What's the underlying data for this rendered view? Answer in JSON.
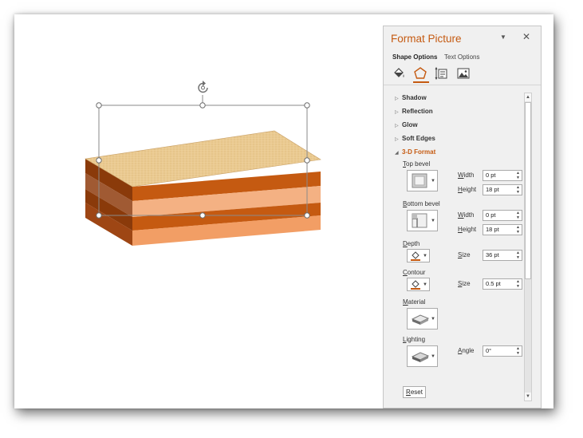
{
  "pane": {
    "title": "Format Picture",
    "menu_icon": "caret-down-icon",
    "close_icon": "close-icon",
    "tabs": [
      "Shape Options",
      "Text Options"
    ],
    "icon_tabs": [
      "fill-line-icon",
      "effects-pentagon-icon",
      "size-properties-icon",
      "picture-icon"
    ],
    "accent_color": "#c55a11"
  },
  "sections": {
    "shadow": "Shadow",
    "reflection": "Reflection",
    "glow": "Glow",
    "soft_edges": "Soft Edges",
    "format_3d": "3-D Format"
  },
  "format_3d": {
    "top_bevel": {
      "label_pre": "",
      "label_key": "T",
      "label_post": "op bevel"
    },
    "bottom_bevel": {
      "label_pre": "",
      "label_key": "B",
      "label_post": "ottom bevel"
    },
    "width_label": {
      "key": "W",
      "rest": "idth"
    },
    "height_label": {
      "key": "H",
      "rest": "eight"
    },
    "top_width": "0 pt",
    "top_height": "18 pt",
    "bottom_width": "0 pt",
    "bottom_height": "18 pt",
    "depth": {
      "key": "D",
      "rest": "epth"
    },
    "depth_size_label": {
      "key": "S",
      "rest": "ize"
    },
    "depth_size": "36 pt",
    "contour": {
      "key": "C",
      "rest": "ontour"
    },
    "contour_size_label": {
      "key": "S",
      "rest": "ize"
    },
    "contour_size": "0.5 pt",
    "material": {
      "key": "M",
      "rest": "aterial"
    },
    "lighting": {
      "key": "L",
      "rest": "ighting"
    },
    "angle_label": {
      "key": "A",
      "rest": "ngle"
    },
    "angle": "0°",
    "reset": {
      "key": "R",
      "rest": "eset"
    }
  },
  "canvas": {
    "rotate_icon": "rotate-handle-icon",
    "shape_colors": {
      "wood_top": "#e9c98f",
      "orange_dark": "#c85a14",
      "orange_light": "#f4b183"
    }
  }
}
